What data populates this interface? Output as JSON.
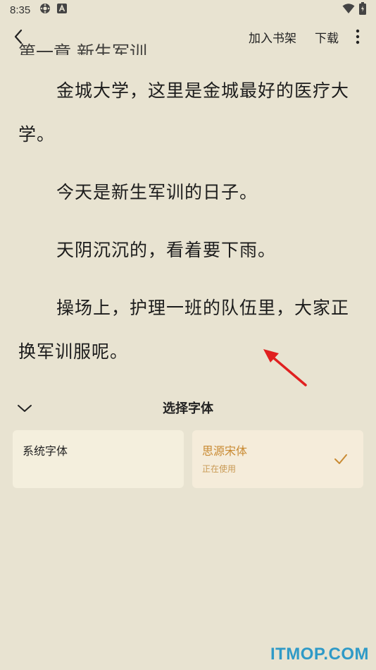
{
  "status_bar": {
    "time": "8:35",
    "icons": [
      "settings-icon",
      "text-a-icon",
      "wifi-icon",
      "battery-icon"
    ]
  },
  "top_bar": {
    "add_to_shelf": "加入书架",
    "download": "下载"
  },
  "content": {
    "cut_line": "第一章 新生军训",
    "paragraphs": [
      "金城大学，这里是金城最好的医疗大学。",
      "今天是新生军训的日子。",
      "天阴沉沉的，看着要下雨。",
      "操场上，护理一班的队伍里，大家正换军训服呢。"
    ]
  },
  "font_panel": {
    "title": "选择字体",
    "fonts": [
      {
        "name": "系统字体",
        "status": ""
      },
      {
        "name": "思源宋体",
        "status": "正在使用"
      }
    ]
  },
  "colors": {
    "background": "#e8e3d1",
    "accent": "#c98a32",
    "arrow": "#e02020",
    "watermark": "#2f9ac7"
  },
  "watermark": "ITMOP.COM"
}
